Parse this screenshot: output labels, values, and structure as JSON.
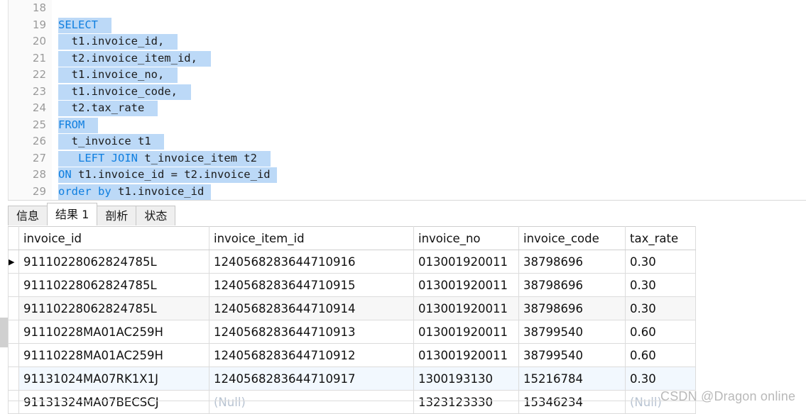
{
  "editor": {
    "lines": [
      {
        "num": "18",
        "tokens": []
      },
      {
        "num": "19",
        "tokens": [
          {
            "t": "SELECT",
            "k": "kw",
            "s": true
          },
          {
            "t": "  ",
            "k": "id",
            "s": true
          }
        ]
      },
      {
        "num": "20",
        "tokens": [
          {
            "t": "  t1.invoice_id,",
            "k": "id",
            "s": true
          },
          {
            "t": "  ",
            "k": "id",
            "s": true
          }
        ]
      },
      {
        "num": "21",
        "tokens": [
          {
            "t": "  t2.invoice_item_id,",
            "k": "id",
            "s": true
          },
          {
            "t": "  ",
            "k": "id",
            "s": true
          }
        ]
      },
      {
        "num": "22",
        "tokens": [
          {
            "t": "  t1.invoice_no,",
            "k": "id",
            "s": true
          },
          {
            "t": "  ",
            "k": "id",
            "s": true
          }
        ]
      },
      {
        "num": "23",
        "tokens": [
          {
            "t": "  t1.invoice_code,",
            "k": "id",
            "s": true
          },
          {
            "t": "  ",
            "k": "id",
            "s": true
          }
        ]
      },
      {
        "num": "24",
        "tokens": [
          {
            "t": "  t2.tax_rate",
            "k": "id",
            "s": true
          },
          {
            "t": "  ",
            "k": "id",
            "s": true
          }
        ]
      },
      {
        "num": "25",
        "tokens": [
          {
            "t": "FROM",
            "k": "kw",
            "s": true
          },
          {
            "t": "  ",
            "k": "id",
            "s": true
          }
        ]
      },
      {
        "num": "26",
        "tokens": [
          {
            "t": "  t_invoice t1",
            "k": "id",
            "s": true
          },
          {
            "t": "  ",
            "k": "id",
            "s": true
          }
        ]
      },
      {
        "num": "27",
        "tokens": [
          {
            "t": "   ",
            "k": "id",
            "s": true
          },
          {
            "t": "LEFT JOIN",
            "k": "kw",
            "s": true
          },
          {
            "t": " t_invoice_item t2",
            "k": "id",
            "s": true
          },
          {
            "t": "  ",
            "k": "id",
            "s": true
          }
        ]
      },
      {
        "num": "28",
        "tokens": [
          {
            "t": "ON",
            "k": "kw",
            "s": true
          },
          {
            "t": " t1.invoice_id = t2.invoice_id",
            "k": "id",
            "s": true
          },
          {
            "t": " ",
            "k": "id",
            "s": true
          }
        ]
      },
      {
        "num": "29",
        "tokens": [
          {
            "t": "order by",
            "k": "kw",
            "s": true
          },
          {
            "t": " t1.invoice_id",
            "k": "id",
            "s": true
          },
          {
            "t": " ",
            "k": "id",
            "s": true
          }
        ]
      }
    ],
    "colors": {
      "keyword": "#0f7fe0",
      "identifier": "#1c1c1c",
      "selection": "#bcd9f7",
      "line_number": "#9a9a9a"
    }
  },
  "tabs": [
    {
      "label": "信息",
      "active": false
    },
    {
      "label": "结果 1",
      "active": true
    },
    {
      "label": "剖析",
      "active": false
    },
    {
      "label": "状态",
      "active": false
    }
  ],
  "grid": {
    "row_marker_glyph": "▶",
    "null_label": "(Null)",
    "selected_column": "invoice_id",
    "columns": [
      {
        "key": "invoice_id",
        "label": "invoice_id"
      },
      {
        "key": "invoice_item_id",
        "label": "invoice_item_id"
      },
      {
        "key": "invoice_no",
        "label": "invoice_no"
      },
      {
        "key": "invoice_code",
        "label": "invoice_code"
      },
      {
        "key": "tax_rate",
        "label": "tax_rate"
      }
    ],
    "rows": [
      {
        "marker": true,
        "style": "current",
        "invoice_id": "91110228062824785L",
        "invoice_item_id": "1240568283644710916",
        "invoice_no": "013001920011",
        "invoice_code": "38798696",
        "tax_rate": "0.30"
      },
      {
        "marker": false,
        "style": "plain",
        "invoice_id": "91110228062824785L",
        "invoice_item_id": "1240568283644710915",
        "invoice_no": "013001920011",
        "invoice_code": "38798696",
        "tax_rate": "0.30"
      },
      {
        "marker": false,
        "style": "alt",
        "invoice_id": "91110228062824785L",
        "invoice_item_id": "1240568283644710914",
        "invoice_no": "013001920011",
        "invoice_code": "38798696",
        "tax_rate": "0.30"
      },
      {
        "marker": false,
        "style": "plain",
        "invoice_id": "91110228MA01AC259H",
        "invoice_item_id": "1240568283644710913",
        "invoice_no": "013001920011",
        "invoice_code": "38799540",
        "tax_rate": "0.60"
      },
      {
        "marker": false,
        "style": "plain",
        "invoice_id": "91110228MA01AC259H",
        "invoice_item_id": "1240568283644710912",
        "invoice_no": "013001920011",
        "invoice_code": "38799540",
        "tax_rate": "0.60"
      },
      {
        "marker": false,
        "style": "hl",
        "invoice_id": "91131024MA07RK1X1J",
        "invoice_item_id": "1240568283644710917",
        "invoice_no": "1300193130",
        "invoice_code": "15216784",
        "tax_rate": "0.30"
      },
      {
        "marker": false,
        "style": "plain",
        "invoice_id": "91131324MA07BECSCJ",
        "invoice_item_id": "(Null)",
        "invoice_no": "1323123330",
        "invoice_code": "15346234",
        "tax_rate": "(Null)"
      }
    ]
  },
  "watermark": {
    "text": "CSDN @Dragon online"
  }
}
